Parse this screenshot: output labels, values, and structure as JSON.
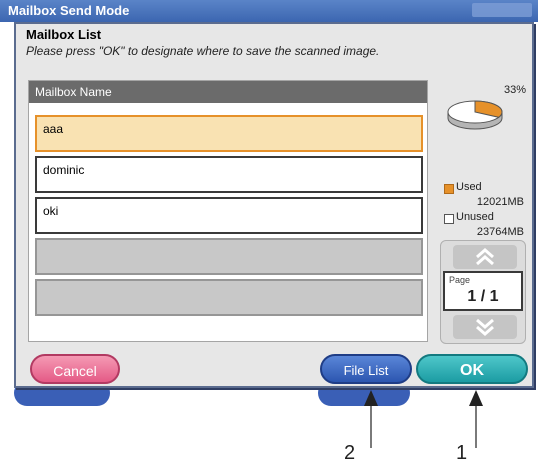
{
  "window": {
    "title": "Mailbox Send Mode"
  },
  "dialog": {
    "title": "Mailbox List",
    "message": "Please press \"OK\" to designate where to save the scanned image."
  },
  "mailbox_list": {
    "header": "Mailbox Name",
    "rows": [
      {
        "name": "aaa",
        "state": "selected"
      },
      {
        "name": "dominic",
        "state": "normal"
      },
      {
        "name": "oki",
        "state": "normal"
      },
      {
        "name": "",
        "state": "empty"
      },
      {
        "name": "",
        "state": "empty"
      }
    ]
  },
  "usage": {
    "percent_label": "33%",
    "used_fraction": 0.33,
    "used_label": "Used",
    "used_value": "12021MB",
    "unused_label": "Unused",
    "unused_value": "23764MB"
  },
  "pager": {
    "label": "Page",
    "value": "1 / 1"
  },
  "buttons": {
    "cancel": "Cancel",
    "file_list": "File List",
    "ok": "OK"
  },
  "callouts": {
    "one": "1",
    "two": "2"
  },
  "colors": {
    "used": "#e6912a",
    "ok": "#1c9ca3",
    "cancel": "#e45a86",
    "file_list": "#2c56b0",
    "title_bar": "#3c66b0"
  }
}
